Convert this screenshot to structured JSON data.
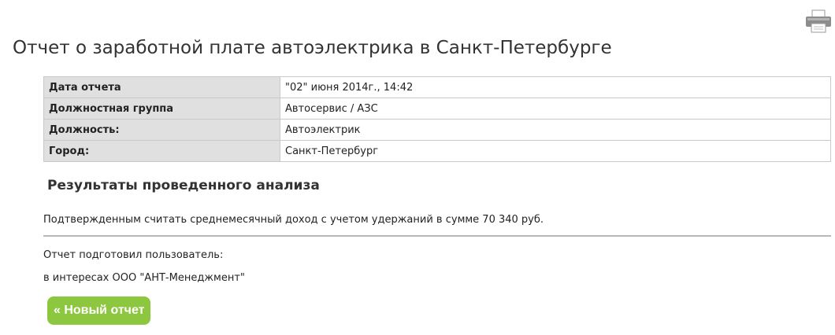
{
  "page": {
    "title": "Отчет о заработной плате автоэлектрика в Санкт-Петербурге",
    "print_icon": "printer-icon"
  },
  "report_info": [
    {
      "label": "Дата отчета",
      "value": "\"02\" июня 2014г., 14:42"
    },
    {
      "label": "Должностная группа",
      "value": "Автосервис / АЗС"
    },
    {
      "label": "Должность:",
      "value": "Автоэлектрик"
    },
    {
      "label": "Город:",
      "value": "Санкт-Петербург"
    }
  ],
  "results": {
    "title": "Результаты проведенного анализа",
    "summary": "Подтвержденным считать среднемесячный доход с учетом удержаний в сумме 70 340 руб.",
    "prepared_by": "Отчет подготовил пользователь:",
    "on_behalf": "в интересах ООО \"АНТ-Менеджмент\""
  },
  "actions": {
    "new_report_label": "« Новый отчет",
    "new_report_color": "#8dc63f"
  }
}
